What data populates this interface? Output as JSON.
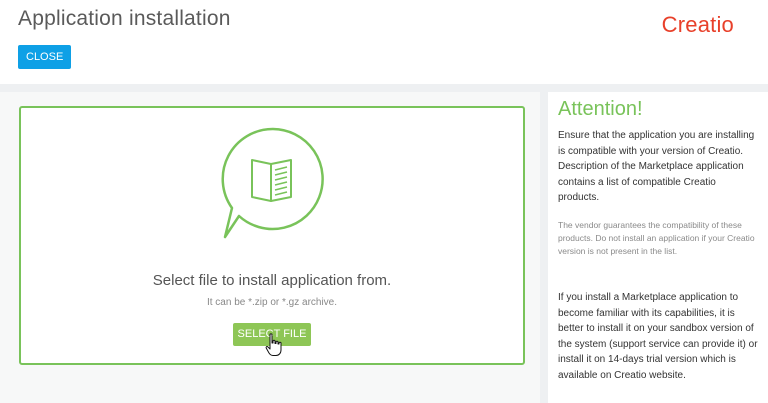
{
  "header": {
    "title": "Application installation",
    "close_label": "CLOSE",
    "logo_text": "Creatio"
  },
  "install": {
    "select_title": "Select file to install application from.",
    "select_hint": "It can be *.zip or *.gz archive.",
    "select_button": "SELECT FILE"
  },
  "attention": {
    "title": "Attention!",
    "paragraph1": "Ensure that the application you are installing is compatible with your version of Creatio. Description of the Marketplace application contains a list of compatible Creatio products.",
    "paragraph2": "The vendor guarantees the compatibility of these products. Do not install an application if your Creatio version is not present in the list.",
    "paragraph3": "If you install a Marketplace application to become familiar with its capabilities, it is better to install it on your sandbox version of the system (support service can provide it) or install it on 14-days trial version which is available on Creatio website."
  },
  "colors": {
    "accent_blue": "#0ea0e6",
    "accent_green": "#79c35a",
    "button_green": "#8ec656",
    "logo_red": "#e8402a"
  },
  "icons": [
    "book-speech-bubble-icon",
    "hand-pointer-cursor-icon"
  ]
}
